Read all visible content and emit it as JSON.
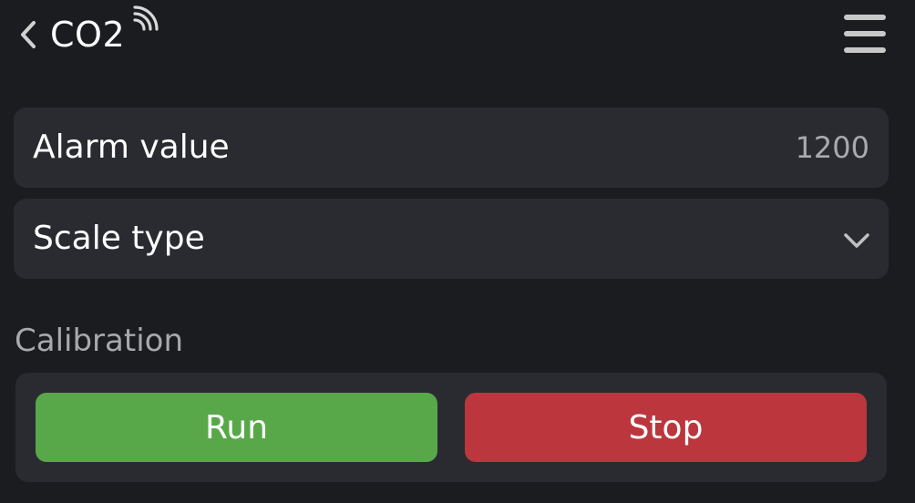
{
  "header": {
    "title": "CO2",
    "back_icon": "chevron-left-icon",
    "signal_icon": "wifi-signal-icon",
    "menu_icon": "hamburger-menu-icon"
  },
  "settings": {
    "alarm": {
      "label": "Alarm value",
      "value": "1200"
    },
    "scale": {
      "label": "Scale type",
      "icon": "chevron-down-icon"
    }
  },
  "calibration": {
    "title": "Calibration",
    "run_label": "Run",
    "stop_label": "Stop"
  },
  "colors": {
    "background": "#1b1c20",
    "card": "#2a2b31",
    "run": "#58a84a",
    "stop": "#bb373d"
  }
}
